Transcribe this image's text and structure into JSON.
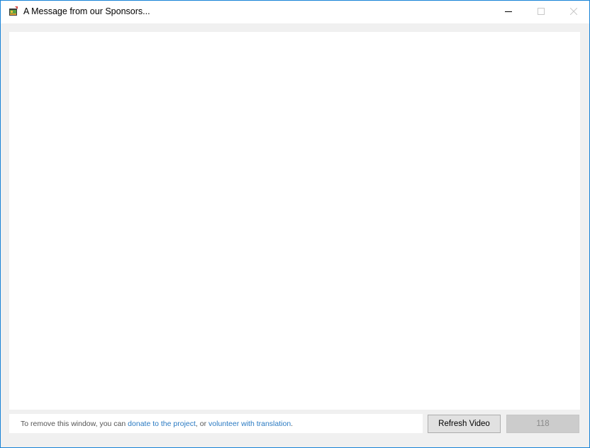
{
  "window": {
    "title": "A Message from our Sponsors...",
    "accent_border": "#1883d7",
    "icon": "app-film-icon"
  },
  "titlebar_buttons": {
    "minimize_icon": "minimize-icon",
    "maximize_icon": "maximize-icon",
    "close_icon": "close-icon"
  },
  "footer": {
    "text_before": "To remove this window, you can ",
    "donate_link": "donate to the project",
    "text_middle": ", or ",
    "volunteer_link": "volunteer with translation",
    "text_after": ".",
    "link_color": "#2a7ac2"
  },
  "buttons": {
    "refresh_label": "Refresh Video",
    "countdown_label": "118"
  }
}
